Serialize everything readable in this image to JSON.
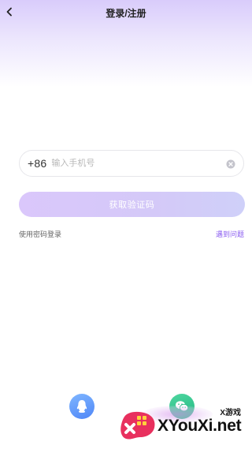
{
  "header": {
    "title": "登录/注册",
    "back_icon": "chevron-left-icon"
  },
  "phone": {
    "country_code": "+86",
    "placeholder": "输入手机号",
    "value": "",
    "clear_icon": "clear-circle-icon"
  },
  "actions": {
    "get_code_label": "获取验证码",
    "password_login_label": "使用密码登录",
    "help_label": "遇到问题"
  },
  "social": {
    "qq_icon": "qq-icon",
    "wechat_icon": "wechat-icon"
  },
  "watermark": {
    "small_text": "X游戏",
    "big_text": "XYouXi.net"
  },
  "colors": {
    "accent": "#8a5cf0",
    "button_gradient_start": "#dac7fb",
    "button_gradient_end": "#cfd0f9",
    "qq_blue": "#4f86f7",
    "wechat_green": "#22b782"
  }
}
